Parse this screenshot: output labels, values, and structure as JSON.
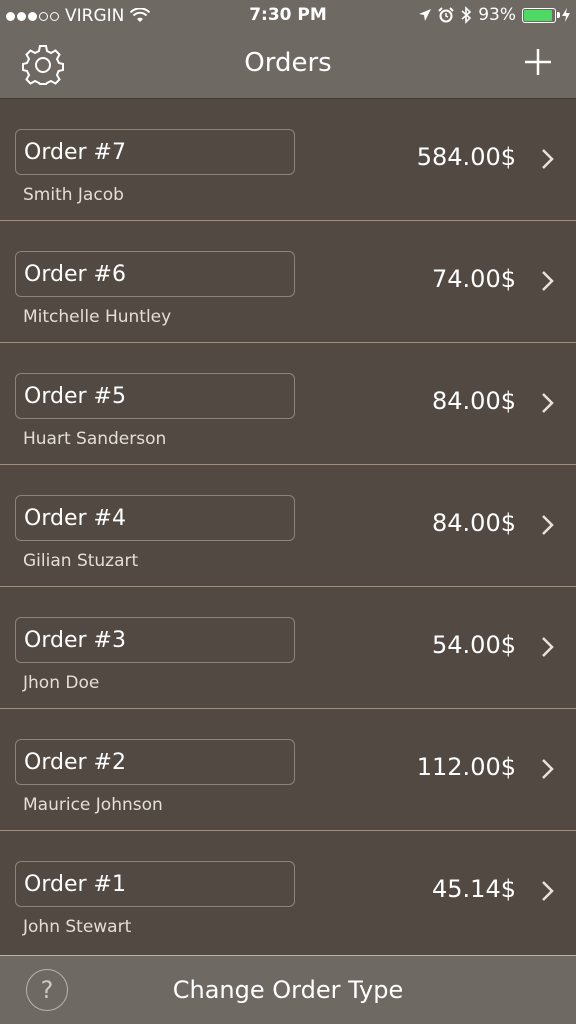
{
  "status_bar": {
    "carrier": "VIRGIN",
    "time": "7:30 PM",
    "battery": "93%",
    "battery_level": 0.93
  },
  "nav": {
    "title": "Orders",
    "settings_icon": "gear-icon",
    "add_icon": "plus-icon"
  },
  "orders": [
    {
      "title": "Order #7",
      "customer": "Smith Jacob",
      "amount": "584.00$"
    },
    {
      "title": "Order #6",
      "customer": "Mitchelle Huntley",
      "amount": "74.00$"
    },
    {
      "title": "Order #5",
      "customer": "Huart Sanderson",
      "amount": "84.00$"
    },
    {
      "title": "Order #4",
      "customer": "Gilian Stuzart",
      "amount": "84.00$"
    },
    {
      "title": "Order #3",
      "customer": "Jhon Doe",
      "amount": "54.00$"
    },
    {
      "title": "Order #2",
      "customer": "Maurice Johnson",
      "amount": "112.00$"
    },
    {
      "title": "Order #1",
      "customer": "John Stewart",
      "amount": "45.14$"
    }
  ],
  "footer": {
    "help_label": "?",
    "change_type_label": "Change Order Type"
  },
  "colors": {
    "background": "#524a42",
    "bar": "#6f6963",
    "battery_fill": "#4cd964"
  }
}
